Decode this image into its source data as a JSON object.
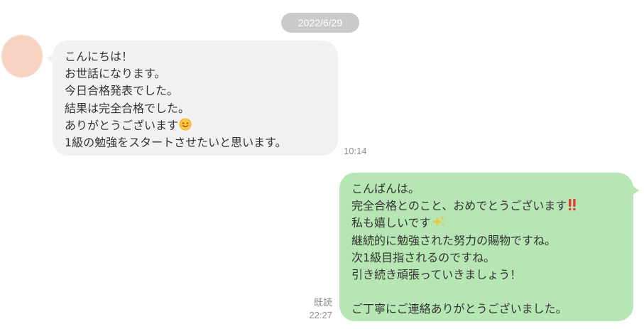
{
  "date_separator": "2022/6/29",
  "incoming_message": {
    "lines": [
      "こんにちは！",
      "お世話になります。",
      "今日合格発表でした。",
      "結果は完全合格でした。",
      "ありがとうございます",
      "1級の勉強をスタートさせたいと思います。"
    ],
    "emoji_after_line_5": "smiling-face-icon",
    "time": "10:14"
  },
  "outgoing_message": {
    "lines": [
      "こんばんは。",
      "完全合格とのこと、おめでとうございます",
      "私も嬉しいです",
      "継続的に勉強された努力の賜物ですね。",
      "次1級目指されるのですね。",
      "引き続き頑張っていきましょう！",
      "",
      "ご丁寧にご連絡ありがとうございました。"
    ],
    "emoji_after_line_2": "double-exclamation-icon",
    "emoji_after_line_3": "sparkles-icon",
    "read_status": "既読",
    "time": "22:27"
  },
  "colors": {
    "incoming_bubble": "#f0f1f3",
    "outgoing_bubble": "#b6e6b3",
    "date_pill": "#c9cacc",
    "avatar": "#f7d2c0",
    "timestamp": "#8a8d92"
  }
}
